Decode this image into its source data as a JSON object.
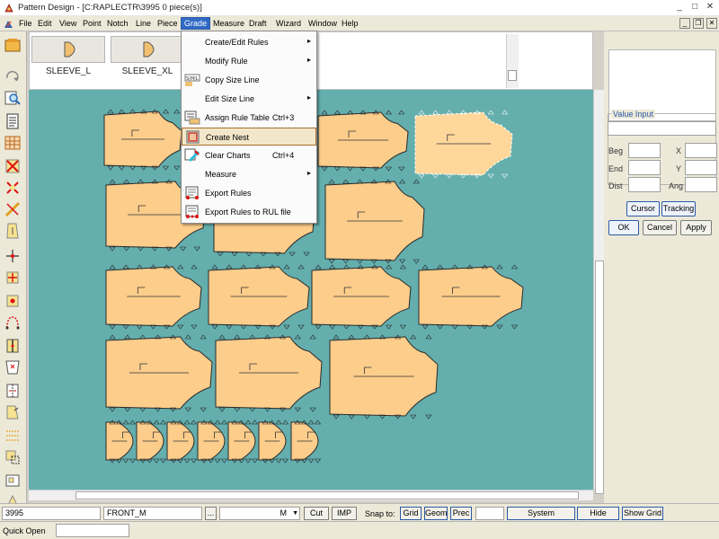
{
  "window": {
    "title": "Pattern Design - [C:RAPLECTR\\3995     0 piece(s)]",
    "controls": {
      "minimize": "_",
      "maximize": "□",
      "close": "✕"
    }
  },
  "menubar": {
    "items": [
      "File",
      "Edit",
      "View",
      "Point",
      "Notch",
      "Line",
      "Piece",
      "Grade",
      "Measure",
      "Draft",
      "Wizard",
      "Window",
      "Help"
    ],
    "active": "Grade",
    "mdi_controls": {
      "minimize": "_",
      "restore": "❐",
      "close": "✕"
    }
  },
  "strip": {
    "thumbnails": [
      "SLEEVE_L",
      "SLEEVE_XL"
    ]
  },
  "grade_menu": {
    "items": [
      {
        "label": "Create/Edit Rules",
        "shortcut": "",
        "submenu": true,
        "icon": ""
      },
      {
        "label": "Modify Rule",
        "shortcut": "",
        "submenu": true,
        "icon": ""
      },
      {
        "label": "Copy Size Line",
        "shortcut": "",
        "submenu": false,
        "icon": "size-line-icon"
      },
      {
        "label": "Edit Size Line",
        "shortcut": "",
        "submenu": true,
        "icon": ""
      },
      {
        "label": "Assign Rule Table",
        "shortcut": "Ctrl+3",
        "submenu": false,
        "icon": "rule-table-icon"
      },
      {
        "label": "Create Nest",
        "shortcut": "",
        "submenu": false,
        "icon": "nest-icon"
      },
      {
        "label": "Clear Charts",
        "shortcut": "Ctrl+4",
        "submenu": false,
        "icon": "clear-charts-icon"
      },
      {
        "label": "Measure",
        "shortcut": "",
        "submenu": true,
        "icon": ""
      },
      {
        "label": "Export Rules",
        "shortcut": "",
        "submenu": false,
        "icon": "export-rules-icon"
      },
      {
        "label": "Export Rules to RUL file",
        "shortcut": "",
        "submenu": false,
        "icon": "export-rul-icon"
      }
    ],
    "highlighted": "Create Nest",
    "arrow": "▸"
  },
  "value_input": {
    "title": "Value Input",
    "labels": {
      "beg": "Beg",
      "x": "X",
      "end": "End",
      "y": "Y",
      "dist": "Dist",
      "ang": "Ang"
    },
    "buttons": {
      "cursor": "Cursor",
      "tracking": "Tracking",
      "ok": "OK",
      "cancel": "Cancel",
      "apply": "Apply"
    }
  },
  "status": {
    "piece_code": "3995",
    "piece_name": "FRONT_M",
    "ellipsis": "...",
    "unit": "M",
    "cut": "Cut",
    "imp": "IMP",
    "snap_label": "Snap to:",
    "buttons": [
      "Grid",
      "Geom",
      "Prec"
    ],
    "system_smoothing": "System Smoothing",
    "hide_seams": "Hide Seams",
    "show_grid": "Show Grid"
  },
  "quick_open": {
    "label": "Quick Open"
  },
  "colors": {
    "canvas": "#64aeae",
    "piece_fill": "#fccd8b",
    "menu_highlight": "#f3e7c9",
    "active_menu": "#316ac5"
  }
}
